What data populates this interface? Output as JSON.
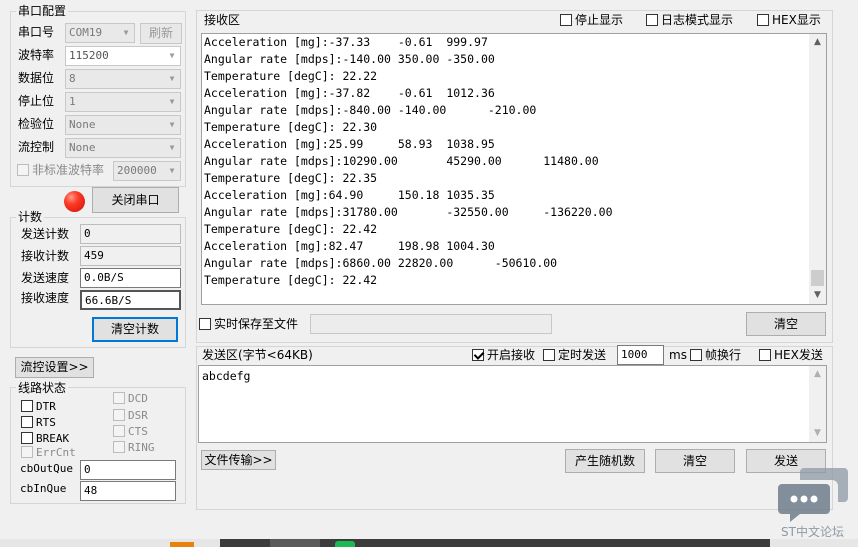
{
  "serial": {
    "title": "串口配置",
    "port_label": "串口号",
    "port_value": "COM19",
    "refresh": "刷新",
    "baud_label": "波特率",
    "baud_value": "115200",
    "databits_label": "数据位",
    "databits_value": "8",
    "stopbits_label": "停止位",
    "stopbits_value": "1",
    "parity_label": "检验位",
    "parity_value": "None",
    "flow_label": "流控制",
    "flow_value": "None",
    "nonstd_label": "非标准波特率",
    "nonstd_value": "200000",
    "close_port": "关闭串口",
    "led_color": "#e8201a"
  },
  "counter": {
    "title": "计数",
    "send_label": "发送计数",
    "send_value": "0",
    "recv_label": "接收计数",
    "recv_value": "459",
    "send_speed_label": "发送速度",
    "send_speed_value": "0.0B/S",
    "recv_speed_label": "接收速度",
    "recv_speed_value": "66.6B/S",
    "clear": "清空计数"
  },
  "flow_settings": "流控设置>>",
  "line_status": {
    "title": "线路状态",
    "dtr": "DTR",
    "rts": "RTS",
    "brk": "BREAK",
    "errcnt": "ErrCnt",
    "dcd": "DCD",
    "dsr": "DSR",
    "cts": "CTS",
    "ring": "RING",
    "out_label": "cbOutQue",
    "out_value": "0",
    "in_label": "cbInQue",
    "in_value": "48"
  },
  "receive": {
    "title": "接收区",
    "stop_display": "停止显示",
    "log_mode": "日志模式显示",
    "hex_display": "HEX显示",
    "lines": [
      "Acceleration [mg]:-37.33    -0.61  999.97",
      "Angular rate [mdps]:-140.00 350.00 -350.00",
      "Temperature [degC]: 22.22",
      "Acceleration [mg]:-37.82    -0.61  1012.36",
      "Angular rate [mdps]:-840.00 -140.00      -210.00",
      "Temperature [degC]: 22.30",
      "Acceleration [mg]:25.99     58.93  1038.95",
      "Angular rate [mdps]:10290.00       45290.00      11480.00",
      "Temperature [degC]: 22.35",
      "Acceleration [mg]:64.90     150.18 1035.35",
      "Angular rate [mdps]:31780.00       -32550.00     -136220.00",
      "Temperature [degC]: 22.42",
      "Acceleration [mg]:82.47     198.98 1004.30",
      "Angular rate [mdps]:6860.00 22820.00      -50610.00",
      "Temperature [degC]: 22.42"
    ],
    "save_realtime": "实时保存至文件",
    "clear": "清空"
  },
  "send": {
    "title": "发送区(字节<64KB)",
    "enable_recv": "开启接收",
    "timed_send": "定时发送",
    "interval": "1000",
    "ms": "ms",
    "frame_newline": "帧换行",
    "hex_send": "HEX发送",
    "content": "abcdefg",
    "file_transfer": "文件传输>>",
    "random": "产生随机数",
    "clear": "清空",
    "send": "发送"
  },
  "watermark": "ST中文论坛"
}
